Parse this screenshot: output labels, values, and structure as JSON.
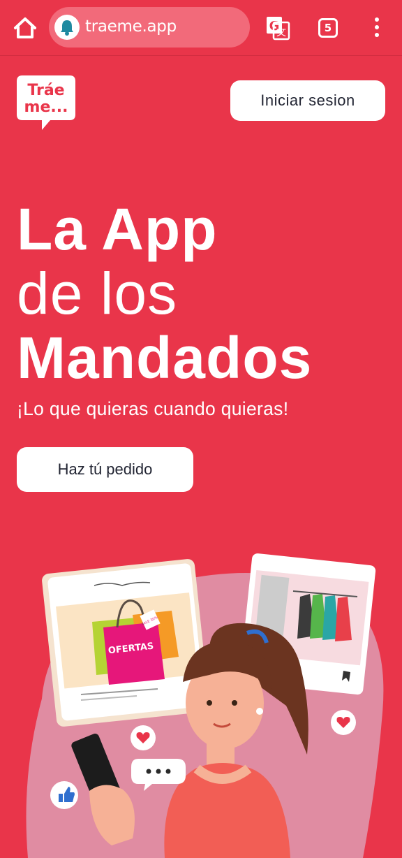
{
  "browser": {
    "url": "traeme.app",
    "tab_count": "5",
    "icons": [
      "home-icon",
      "notification-bell-icon",
      "translate-icon",
      "tabs-icon",
      "menu-dots-icon"
    ]
  },
  "brand": {
    "logo_text_line1": "Tráe",
    "logo_text_line2": "me...",
    "colors": {
      "primary": "#e9354a",
      "text_dark": "#222533",
      "white": "#ffffff"
    }
  },
  "header": {
    "login_label": "Iniciar sesion"
  },
  "hero": {
    "title_line1": "La App",
    "title_line2": "de los",
    "title_line3": "Mandados",
    "subtitle": "¡Lo que quieras cuando quieras!",
    "cta_label": "Haz tú pedido"
  },
  "illustration": {
    "sale_text": "OFERTAS",
    "sale_tag": "SALE 30%"
  }
}
